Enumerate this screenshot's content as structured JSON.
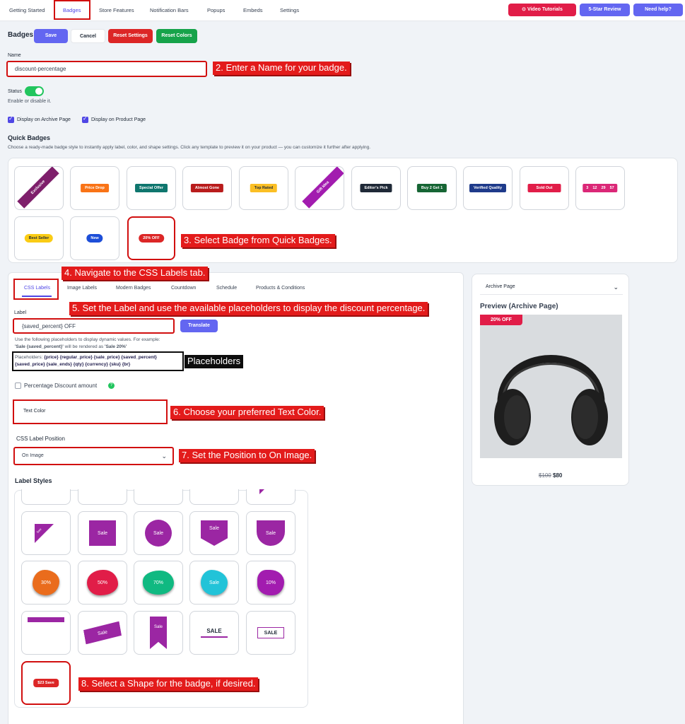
{
  "nav": {
    "tabs": [
      "Getting Started",
      "Badges",
      "Store Features",
      "Notification Bars",
      "Popups",
      "Embeds",
      "Settings"
    ],
    "video_tutorials": "Video Tutorials",
    "review": "5-Star Review",
    "help": "Need help?"
  },
  "header": {
    "title": "Badges",
    "save": "Save",
    "cancel": "Cancel",
    "reset_settings": "Reset Settings",
    "reset_colors": "Reset Colors"
  },
  "name_field": {
    "label": "Name",
    "value": "discount-percentage"
  },
  "status": {
    "label": "Status",
    "hint": "Enable or disable it.",
    "enabled": true
  },
  "display": {
    "archive": "Display on Archive Page",
    "product": "Display on Product Page"
  },
  "quick_badges": {
    "title": "Quick Badges",
    "desc": "Choose a ready-made badge style to instantly apply label, color, and shape settings. Click any template to preview it on your product — you can customize it further after applying.",
    "row1": [
      "Exclusive",
      "Price Drop",
      "Special Offer",
      "Almost Gone",
      "Top Rated",
      "Gift Idea",
      "Editor's Pick",
      "Buy 2 Get 1",
      "Verified Quality",
      "Sold Out"
    ],
    "countdown": [
      "3",
      "12",
      "29",
      "57"
    ],
    "row2": [
      "Best Seller",
      "New",
      "20% OFF"
    ]
  },
  "subtabs": [
    "CSS Labels",
    "Image Labels",
    "Modern Badges",
    "Countdown",
    "Schedule",
    "Products & Conditions"
  ],
  "label_field": {
    "label": "Label",
    "value": "{saved_percent} OFF",
    "translate": "Translate",
    "help1": "Use the following placeholders to display dynamic values. For example:",
    "help2a": "'Sale {saved_percent}'",
    "help2b": " will be rendered as ",
    "help2c": "'Sale 20%'",
    "ph_prefix": "Placeholders: ",
    "ph_line1": "{price} {regular_price} {sale_price} {saved_percent}",
    "ph_line2": "{saved_price} {sale_ends} {qty} {currency} {sku} {br}"
  },
  "percentage_discount": "Percentage Discount amount",
  "text_color": "Text Color",
  "position": {
    "label": "CSS Label Position",
    "value": "On Image"
  },
  "label_styles": {
    "title": "Label Styles",
    "row1": [
      "Sale",
      "Sale",
      "Sale",
      "Sale",
      "Sale"
    ],
    "row2": [
      "30%",
      "50%",
      "70%",
      "Sale",
      "10%"
    ],
    "row3": [
      "Sale",
      "Sale",
      "SALE",
      "SALE"
    ],
    "last": "$23 Save"
  },
  "preview": {
    "select": "Archive Page",
    "title": "Preview (Archive Page)",
    "badge": "20% OFF",
    "old_price": "$100",
    "new_price": "$80"
  },
  "annotations": {
    "a2": "2. Enter a Name for your badge.",
    "a3": "3. Select Badge from Quick Badges.",
    "a4": "4. Navigate to the CSS Labels tab.",
    "a5": "5. Set the Label and use the available placeholders to display the discount percentage.",
    "placeholders": "Placeholders",
    "a6": "6. Choose your preferred Text Color.",
    "a7": "7. Set the Position to On Image.",
    "a8": "8. Select a Shape for the badge, if desired."
  },
  "colors": {
    "primary": "#6366f1",
    "red": "#dc2626",
    "green": "#16a34a",
    "annotation": "#e31b1b"
  }
}
